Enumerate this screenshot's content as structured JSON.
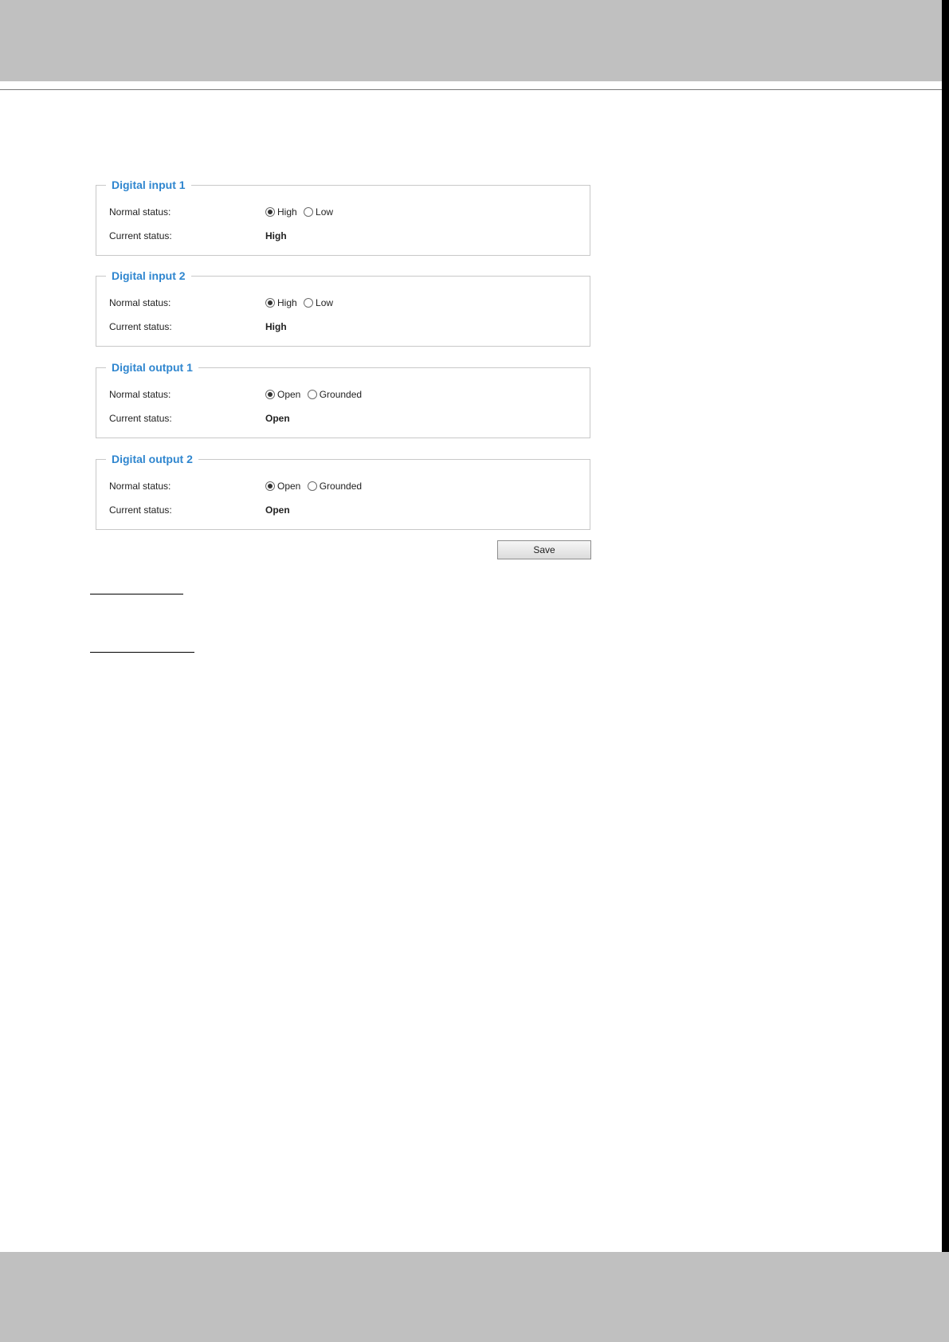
{
  "groups": [
    {
      "title": "Digital input 1",
      "normal_label": "Normal status:",
      "options": [
        {
          "label": "High",
          "checked": true
        },
        {
          "label": "Low",
          "checked": false
        }
      ],
      "current_label": "Current status:",
      "current_value": "High"
    },
    {
      "title": "Digital input 2",
      "normal_label": "Normal status:",
      "options": [
        {
          "label": "High",
          "checked": true
        },
        {
          "label": "Low",
          "checked": false
        }
      ],
      "current_label": "Current status:",
      "current_value": "High"
    },
    {
      "title": "Digital output 1",
      "normal_label": "Normal status:",
      "options": [
        {
          "label": "Open",
          "checked": true
        },
        {
          "label": "Grounded",
          "checked": false
        }
      ],
      "current_label": "Current status:",
      "current_value": "Open"
    },
    {
      "title": "Digital output 2",
      "normal_label": "Normal status:",
      "options": [
        {
          "label": "Open",
          "checked": true
        },
        {
          "label": "Grounded",
          "checked": false
        }
      ],
      "current_label": "Current status:",
      "current_value": "Open"
    }
  ],
  "save_label": "Save",
  "colors": {
    "group_title": "#2f86cf",
    "band": "#c0c0c0"
  }
}
